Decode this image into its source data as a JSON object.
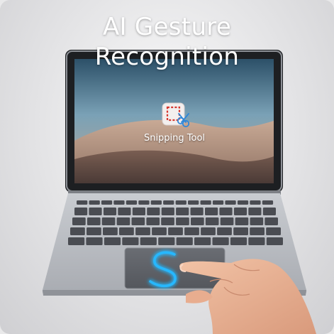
{
  "headline": {
    "line1": "AI Gesture",
    "line2": "Recognition"
  },
  "screen": {
    "app_name": "Snipping Tool",
    "app_icon": "snipping-tool-icon"
  },
  "gesture": {
    "shape": "S",
    "glow_color": "#27b8ff"
  },
  "colors": {
    "laptop_body": "#b9bcc2",
    "keyboard_keys": "#4a4c52",
    "trackpad": "#595c62"
  }
}
